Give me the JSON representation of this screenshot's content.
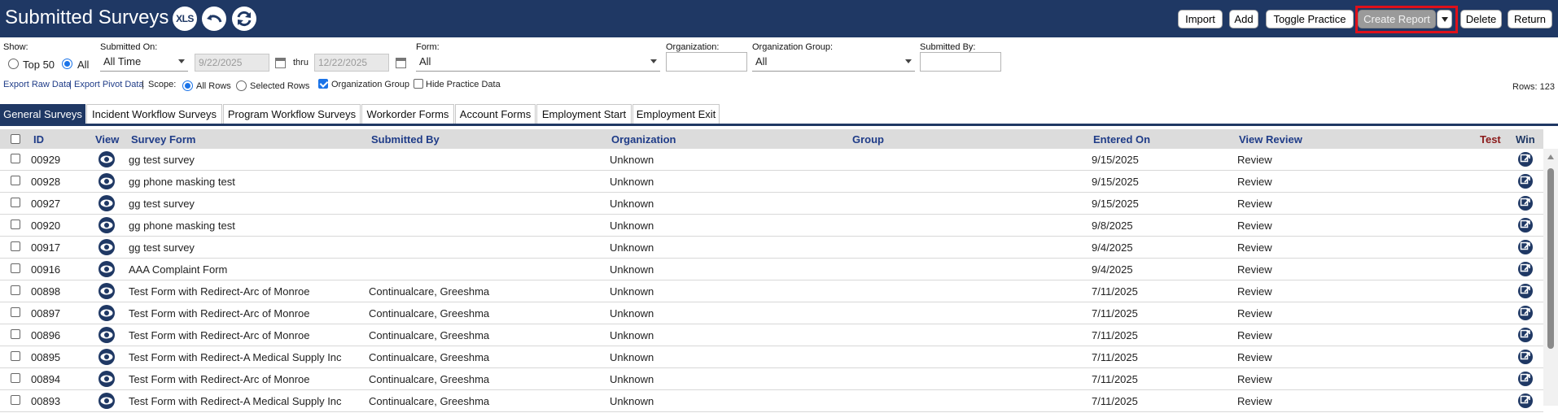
{
  "header": {
    "title": "Submitted Surveys",
    "xls_label": "XLS",
    "buttons": {
      "import": "Import",
      "add": "Add",
      "toggle_practice": "Toggle Practice",
      "create_report": "Create Report",
      "delete": "Delete",
      "return": "Return"
    }
  },
  "filters": {
    "show_label": "Show:",
    "top50_label": "Top 50",
    "all_label": "All",
    "submitted_on_label": "Submitted On:",
    "submitted_on_value": "All Time",
    "date_from": "9/22/2025",
    "thru_label": "thru",
    "date_to": "12/22/2025",
    "form_label": "Form:",
    "form_value": "All",
    "organization_label": "Organization:",
    "organization_value": "",
    "org_group_label": "Organization Group:",
    "org_group_value": "All",
    "submitted_by_label": "Submitted By:",
    "submitted_by_value": "",
    "export_raw": "Export Raw Data",
    "export_sep": "|",
    "export_pivot": "Export Pivot Data",
    "export_sep2": "|",
    "scope_label": "Scope:",
    "all_rows_label": "All Rows",
    "selected_rows_label": "Selected Rows",
    "org_group_chk_label": "Organization Group",
    "hide_practice_label": "Hide Practice Data",
    "rows_count": "Rows: 123"
  },
  "tabs": [
    "General Surveys",
    "Incident Workflow Surveys",
    "Program Workflow Surveys",
    "Workorder Forms",
    "Account Forms",
    "Employment Start",
    "Employment Exit"
  ],
  "table": {
    "columns": {
      "id": "ID",
      "view": "View",
      "survey_form": "Survey Form",
      "submitted_by": "Submitted By",
      "organization": "Organization",
      "group": "Group",
      "entered_on": "Entered On",
      "view_review": "View Review",
      "test": "Test",
      "win": "Win"
    },
    "rows": [
      {
        "id": "00929",
        "form": "gg test survey",
        "submitted_by": "",
        "org": "Unknown",
        "group": "",
        "entered": "9/15/2025",
        "review": "Review"
      },
      {
        "id": "00928",
        "form": "gg phone masking test",
        "submitted_by": "",
        "org": "Unknown",
        "group": "",
        "entered": "9/15/2025",
        "review": "Review"
      },
      {
        "id": "00927",
        "form": "gg test survey",
        "submitted_by": "",
        "org": "Unknown",
        "group": "",
        "entered": "9/15/2025",
        "review": "Review"
      },
      {
        "id": "00920",
        "form": "gg phone masking test",
        "submitted_by": "",
        "org": "Unknown",
        "group": "",
        "entered": "9/8/2025",
        "review": "Review"
      },
      {
        "id": "00917",
        "form": "gg test survey",
        "submitted_by": "",
        "org": "Unknown",
        "group": "",
        "entered": "9/4/2025",
        "review": "Review"
      },
      {
        "id": "00916",
        "form": "AAA Complaint Form",
        "submitted_by": "",
        "org": "Unknown",
        "group": "",
        "entered": "9/4/2025",
        "review": "Review"
      },
      {
        "id": "00898",
        "form": "Test Form with Redirect-Arc of Monroe",
        "submitted_by": "Continualcare, Greeshma",
        "org": "Unknown",
        "group": "",
        "entered": "7/11/2025",
        "review": "Review"
      },
      {
        "id": "00897",
        "form": "Test Form with Redirect-Arc of Monroe",
        "submitted_by": "Continualcare, Greeshma",
        "org": "Unknown",
        "group": "",
        "entered": "7/11/2025",
        "review": "Review"
      },
      {
        "id": "00896",
        "form": "Test Form with Redirect-Arc of Monroe",
        "submitted_by": "Continualcare, Greeshma",
        "org": "Unknown",
        "group": "",
        "entered": "7/11/2025",
        "review": "Review"
      },
      {
        "id": "00895",
        "form": "Test Form with Redirect-A Medical Supply Inc",
        "submitted_by": "Continualcare, Greeshma",
        "org": "Unknown",
        "group": "",
        "entered": "7/11/2025",
        "review": "Review"
      },
      {
        "id": "00894",
        "form": "Test Form with Redirect-Arc of Monroe",
        "submitted_by": "Continualcare, Greeshma",
        "org": "Unknown",
        "group": "",
        "entered": "7/11/2025",
        "review": "Review"
      },
      {
        "id": "00893",
        "form": "Test Form with Redirect-A Medical Supply Inc",
        "submitted_by": "Continualcare, Greeshma",
        "org": "Unknown",
        "group": "",
        "entered": "7/11/2025",
        "review": "Review"
      }
    ]
  },
  "colors": {
    "header_bg": "#1f3864",
    "highlight": "#e0101a",
    "link": "#1f3c88"
  }
}
